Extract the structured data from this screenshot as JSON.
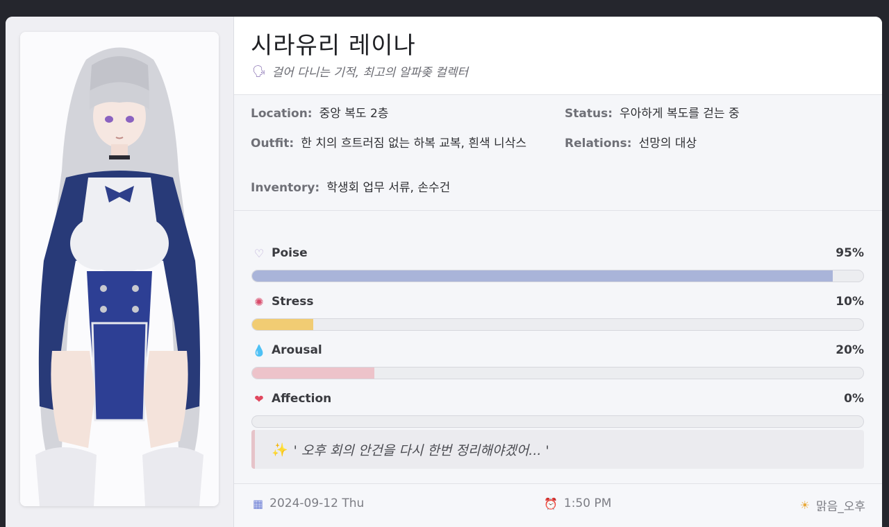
{
  "character": {
    "name": "시라유리 레이나",
    "subtitle_icon": "speaking-head-icon",
    "subtitle": "걸어 다니는 기적, 최고의 알파좆 컬렉터"
  },
  "info": {
    "location": {
      "label": "Location:",
      "value": "중앙 복도 2층"
    },
    "status": {
      "label": "Status:",
      "value": "우아하게 복도를 걷는 중"
    },
    "outfit": {
      "label": "Outfit:",
      "value": "한 치의 흐트러짐 없는 하복 교복, 흰색 니삭스"
    },
    "relations": {
      "label": "Relations:",
      "value": "선망의 대상"
    },
    "inventory": {
      "label": "Inventory:",
      "value": "학생회 업무 서류, 손수건"
    }
  },
  "stats": [
    {
      "icon": "heart-icon",
      "glyph": "♡",
      "label": "Poise",
      "value_text": "95%",
      "value": 95,
      "color": "#a9b4d9"
    },
    {
      "icon": "anger-icon",
      "glyph": "✺",
      "label": "Stress",
      "value_text": "10%",
      "value": 10,
      "color": "#f1cc73"
    },
    {
      "icon": "droplet-icon",
      "glyph": "💧",
      "label": "Arousal",
      "value_text": "20%",
      "value": 20,
      "color": "#edc3ca"
    },
    {
      "icon": "heart-icon",
      "glyph": "❤",
      "label": "Affection",
      "value_text": "0%",
      "value": 0,
      "color": "#e35a6e"
    }
  ],
  "quote": {
    "icon": "sparkles-icon",
    "text": "' 오후 회의 안건을 다시 한번 정리해야겠어... '"
  },
  "footer": {
    "date": "2024-09-12 Thu",
    "time": "1:50 PM",
    "weather": "맑음_오후"
  },
  "colors": {
    "background": "#25262d",
    "card": "#f5f6f9",
    "accent_quote_border": "#e6c3c9"
  }
}
